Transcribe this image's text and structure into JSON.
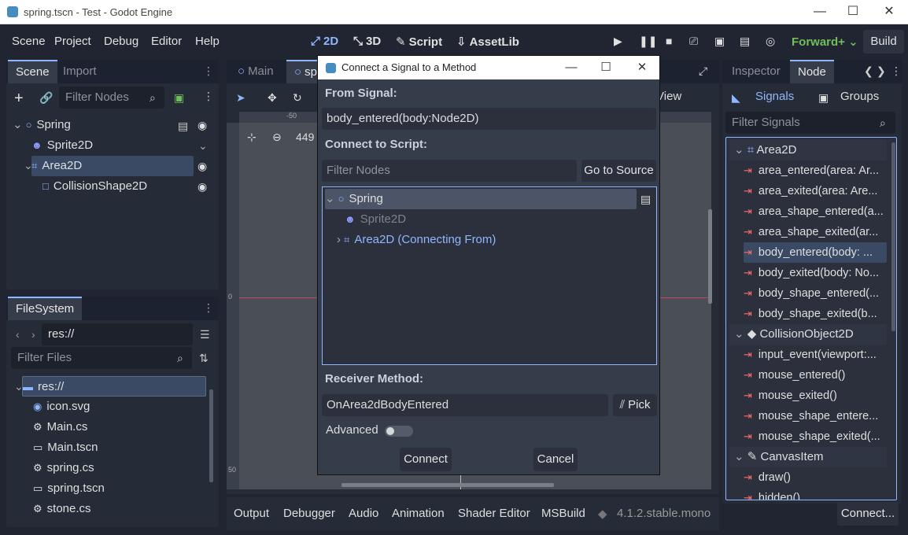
{
  "window": {
    "title": "spring.tscn - Test - Godot Engine"
  },
  "menu": [
    "Scene",
    "Project",
    "Debug",
    "Editor",
    "Help"
  ],
  "workspaces": [
    {
      "label": "2D",
      "glyph": "⤢"
    },
    {
      "label": "3D",
      "glyph": "⤡"
    },
    {
      "label": "Script",
      "glyph": "✎"
    },
    {
      "label": "AssetLib",
      "glyph": "⇩"
    }
  ],
  "renderer": "Forward+",
  "build": "Build",
  "scene_panel": {
    "tabs": [
      "Scene",
      "Import"
    ],
    "filter_placeholder": "Filter Nodes",
    "tree": [
      "Spring",
      "Sprite2D",
      "Area2D",
      "CollisionShape2D"
    ]
  },
  "filesystem": {
    "tab": "FileSystem",
    "path": "res://",
    "filter_placeholder": "Filter Files",
    "items": [
      "res://",
      "icon.svg",
      "Main.cs",
      "Main.tscn",
      "spring.cs",
      "spring.tscn",
      "stone.cs"
    ]
  },
  "viewport": {
    "tabs": [
      "Main",
      "sp"
    ],
    "zoom": "449",
    "view_label": "View",
    "ruler_labels": [
      "-50",
      "0",
      "50"
    ]
  },
  "bottom": {
    "tabs": [
      "Output",
      "Debugger",
      "Audio",
      "Animation",
      "Shader Editor",
      "MSBuild"
    ],
    "version": "4.1.2.stable.mono"
  },
  "inspector": {
    "tabs": [
      "Inspector",
      "Node"
    ],
    "subtabs": [
      "Signals",
      "Groups"
    ],
    "filter_placeholder": "Filter Signals",
    "groups": [
      {
        "name": "Area2D",
        "signals": [
          "area_entered(area: Ar...",
          "area_exited(area: Are...",
          "area_shape_entered(a...",
          "area_shape_exited(ar...",
          "body_entered(body: ...",
          "body_exited(body: No...",
          "body_shape_entered(...",
          "body_shape_exited(b..."
        ]
      },
      {
        "name": "CollisionObject2D",
        "signals": [
          "input_event(viewport:...",
          "mouse_entered()",
          "mouse_exited()",
          "mouse_shape_entere...",
          "mouse_shape_exited(..."
        ]
      },
      {
        "name": "CanvasItem",
        "signals": [
          "draw()",
          "hidden()"
        ]
      }
    ],
    "connect_button": "Connect..."
  },
  "dialog": {
    "title": "Connect a Signal to a Method",
    "from_signal_label": "From Signal:",
    "from_signal_value": "body_entered(body:Node2D)",
    "connect_to_label": "Connect to Script:",
    "filter_placeholder": "Filter Nodes",
    "goto_source": "Go to Source",
    "tree": [
      "Spring",
      "Sprite2D",
      "Area2D (Connecting From)"
    ],
    "receiver_label": "Receiver Method:",
    "receiver_value": "OnArea2dBodyEntered",
    "pick": "Pick",
    "advanced": "Advanced",
    "connect": "Connect",
    "cancel": "Cancel"
  },
  "colors": {
    "accent": "#8fb7ff",
    "renderer": "#6fbf5a",
    "signal_arrow": "#ff6b6b",
    "connecting_from": "#8fb7ff"
  }
}
